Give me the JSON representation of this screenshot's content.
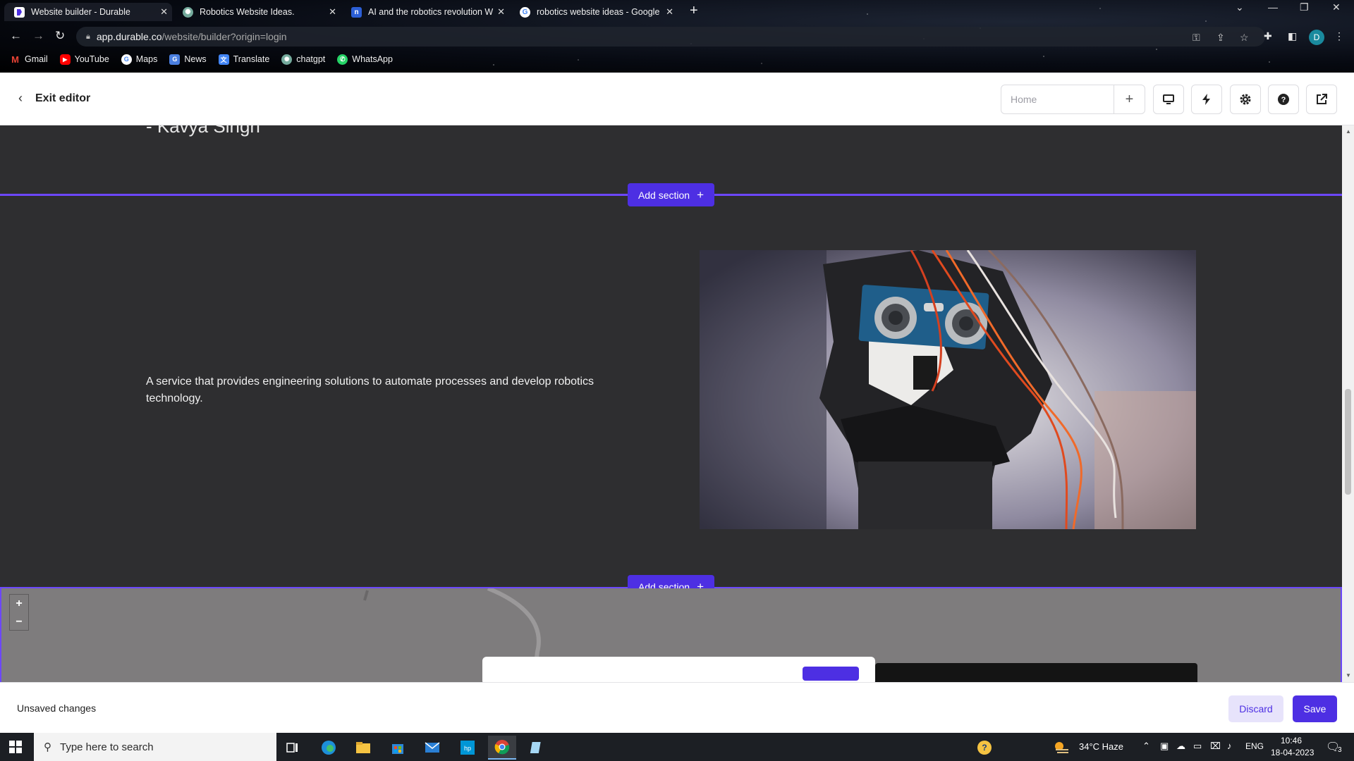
{
  "browser": {
    "tabs": [
      {
        "title": "Website builder - Durable",
        "favicon": "durable-icon",
        "active": true
      },
      {
        "title": "Robotics Website Ideas.",
        "favicon": "chatgpt-icon",
        "active": false
      },
      {
        "title": "AI and the robotics revolution W",
        "favicon": "notion-icon",
        "active": false
      },
      {
        "title": "robotics website ideas - Google",
        "favicon": "google-icon",
        "active": false
      }
    ],
    "url_host": "app.durable.co",
    "url_path": "/website/builder?origin=login",
    "profile_initial": "D",
    "bookmarks": [
      {
        "label": "Gmail",
        "icon": "gmail-icon"
      },
      {
        "label": "YouTube",
        "icon": "youtube-icon"
      },
      {
        "label": "Maps",
        "icon": "google-maps-icon"
      },
      {
        "label": "News",
        "icon": "news-icon"
      },
      {
        "label": "Translate",
        "icon": "translate-icon"
      },
      {
        "label": "chatgpt",
        "icon": "chatgpt-icon"
      },
      {
        "label": "WhatsApp",
        "icon": "whatsapp-icon"
      }
    ]
  },
  "editor": {
    "exit_label": "Exit editor",
    "page_select_value": "Home",
    "toolbar_icons": [
      "desktop-icon",
      "lightning-icon",
      "gear-icon",
      "help-icon",
      "external-link-icon"
    ]
  },
  "canvas": {
    "quote_author": "- Kavya Singh",
    "add_section_label": "Add section",
    "about_text": "A service that provides engineering solutions to automate processes and develop robotics technology.",
    "zoom_in": "+",
    "zoom_out": "−"
  },
  "footer": {
    "status": "Unsaved changes",
    "discard_label": "Discard",
    "save_label": "Save"
  },
  "taskbar": {
    "search_placeholder": "Type here to search",
    "weather": "34°C  Haze",
    "language": "ENG",
    "time": "10:46",
    "date": "18-04-2023",
    "notification_count": "3"
  },
  "colors": {
    "accent": "#4d2fe3",
    "section_divider": "#6c47ff",
    "canvas_bg": "#2e2e30"
  }
}
